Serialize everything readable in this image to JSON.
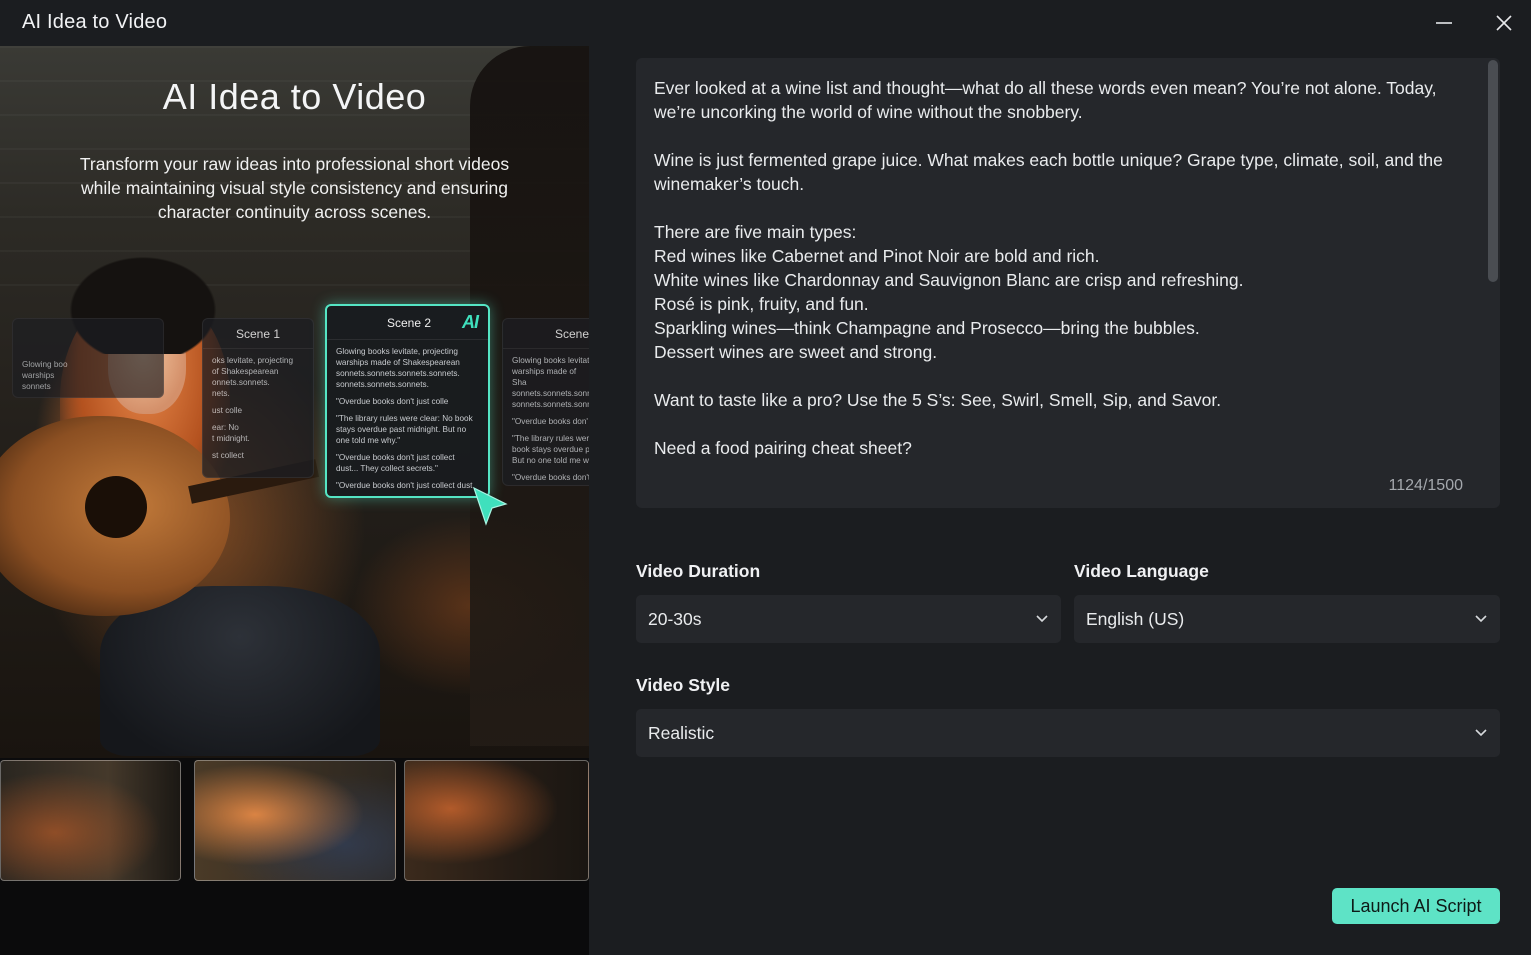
{
  "window": {
    "title": "AI Idea to Video"
  },
  "hero": {
    "title": "AI Idea to Video",
    "subtitle": "Transform your raw ideas into professional short videos while maintaining visual style consistency and ensuring character continuity across scenes.",
    "cards": {
      "left": {
        "head": "",
        "lines": [
          "Glowing boo",
          "warships",
          "sonnets"
        ]
      },
      "scene1": {
        "head": "Scene 1",
        "lines": [
          "oks levitate, projecting",
          "of Shakespearean",
          "onnets.sonnets.",
          "nets.",
          "ust colle",
          "ear: No",
          "t midnight.",
          "st collect"
        ]
      },
      "scene2": {
        "head": "Scene 2",
        "badge": "AI",
        "lines": [
          "Glowing books levitate, projecting warships made of Shakespearean sonnets.sonnets.sonnets.sonnets. sonnets.sonnets.sonnets.",
          "\"Overdue books don't just colle",
          "\"The library rules were clear: No book stays overdue past midnight. But no one told me why.\"",
          "\"Overdue books don't just collect dust... They collect secrets.\"",
          "\"Overdue books don't just collect dust"
        ]
      },
      "scene3": {
        "head": "Scene",
        "lines": [
          "Glowing books levitat",
          "warships made of Sha",
          "sonnets.sonnets.sonn",
          "sonnets.sonnets.sonn",
          "\"Overdue books don'",
          "\"The library rules wer",
          "book stays overdue p",
          "But no one told me w",
          "\"Overdue books don't"
        ]
      }
    }
  },
  "script": {
    "text": "Ever looked at a wine list and thought—what do all these words even mean? You’re not alone. Today, we’re uncorking the world of wine without the snobbery.\n\nWine is just fermented grape juice. What makes each bottle unique? Grape type, climate, soil, and the winemaker’s touch.\n\nThere are five main types:\nRed wines like Cabernet and Pinot Noir are bold and rich.\nWhite wines like Chardonnay and Sauvignon Blanc are crisp and refreshing.\nRosé is pink, fruity, and fun.\nSparkling wines—think Champagne and Prosecco—bring the bubbles.\nDessert wines are sweet and strong.\n\nWant to taste like a pro? Use the 5 S’s: See, Swirl, Smell, Sip, and Savor.\n\nNeed a food pairing cheat sheet?",
    "counter": "1124/1500"
  },
  "form": {
    "duration": {
      "label": "Video Duration",
      "value": "20-30s"
    },
    "language": {
      "label": "Video Language",
      "value": "English (US)"
    },
    "style": {
      "label": "Video Style",
      "value": "Realistic"
    }
  },
  "actions": {
    "launch_label": "Launch AI Script"
  },
  "colors": {
    "accent": "#5ee3c6",
    "background": "#1b1d20",
    "field": "#25272b"
  }
}
